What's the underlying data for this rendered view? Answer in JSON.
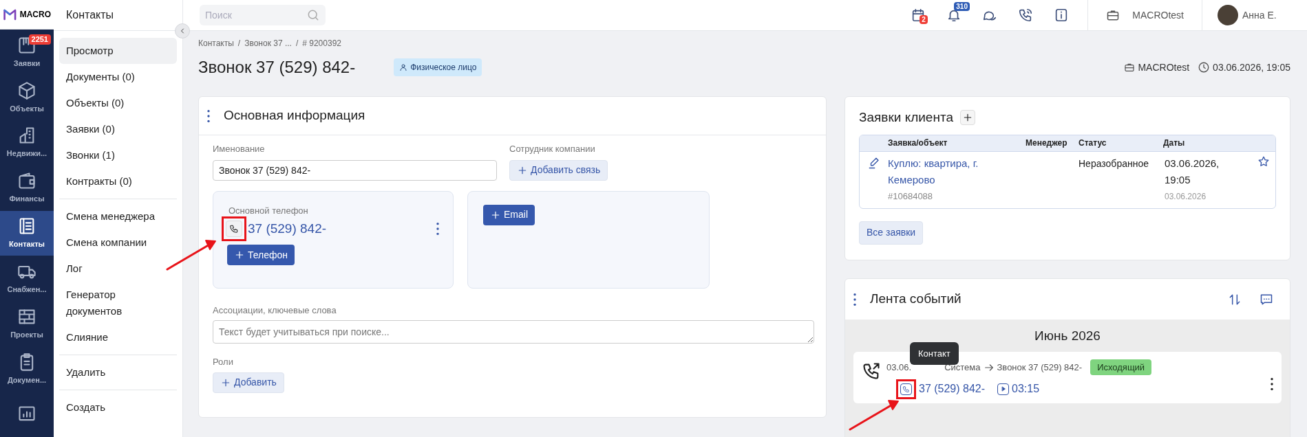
{
  "logo": {
    "text": "MACRO"
  },
  "nav": [
    {
      "label": "Заявки",
      "badge": "2251",
      "selected": false
    },
    {
      "label": "Объекты",
      "selected": false
    },
    {
      "label": "Недвижи...",
      "selected": false
    },
    {
      "label": "Финансы",
      "selected": false
    },
    {
      "label": "Контакты",
      "selected": true
    },
    {
      "label": "Снабжен...",
      "selected": false
    },
    {
      "label": "Проекты",
      "selected": false
    },
    {
      "label": "Докумен...",
      "selected": false
    },
    {
      "selected": false
    }
  ],
  "sidebar": {
    "title": "Контакты",
    "groups": [
      [
        {
          "label": "Просмотр",
          "selected": true
        },
        {
          "label": "Документы (0)",
          "selected": false
        },
        {
          "label": "Объекты (0)",
          "selected": false
        },
        {
          "label": "Заявки (0)",
          "selected": false
        },
        {
          "label": "Звонки (1)",
          "selected": false
        },
        {
          "label": "Контракты (0)",
          "selected": false
        }
      ],
      [
        {
          "label": "Смена менеджера",
          "selected": false
        },
        {
          "label": "Смена компании",
          "selected": false
        },
        {
          "label": "Лог",
          "selected": false
        },
        {
          "label": "Генератор документов",
          "selected": false
        },
        {
          "label": "Слияние",
          "selected": false
        }
      ],
      [
        {
          "label": "Удалить",
          "selected": false
        }
      ],
      [
        {
          "label": "Создать",
          "selected": false
        }
      ]
    ]
  },
  "topbar": {
    "search_placeholder": "Поиск",
    "calendar_badge": "2",
    "notifications_badge": "310",
    "company": "MACROtest",
    "user": "Анна Е."
  },
  "header": {
    "breadcrumbs": [
      "Контакты",
      "Звонок 37 ...",
      "# 9200392"
    ],
    "breadcrumb_separators": [
      "/",
      "/"
    ],
    "title": "Звонок 37 (529) 842-",
    "tag": "Физическое лицо",
    "company": "MACROtest",
    "date": "03.06.2026, 19:05"
  },
  "main_info": {
    "title": "Основная информация",
    "name": {
      "label": "Именование",
      "value": "Звонок 37 (529) 842-"
    },
    "employee": {
      "label": "Сотрудник компании",
      "button": "Добавить связь"
    },
    "phone": {
      "label": "Основной телефон",
      "number": "37 (529) 842-",
      "button": "Телефон"
    },
    "email": {
      "button": "Email"
    },
    "keywords": {
      "label": "Ассоциации, ключевые слова",
      "placeholder": "Текст будет учитываться при поиске..."
    },
    "roles": {
      "label": "Роли",
      "button": "Добавить"
    }
  },
  "client_requests": {
    "title": "Заявки клиента",
    "columns": [
      "Заявка/объект",
      "Менеджер",
      "Статус",
      "Даты"
    ],
    "rows": [
      {
        "title": "Куплю: квартира, г. Кемерово",
        "id": "#10684088",
        "status": "Неразобранное",
        "date": "03.06.2026, 19:05",
        "date_created": "03.06.2026",
        "starred": false
      }
    ],
    "button": "Все заявки"
  },
  "feed": {
    "title": "Лента событий",
    "month": "Июнь 2026",
    "events": [
      {
        "date": "03.06.",
        "from": "Система",
        "to": "Звонок 37 (529) 842-",
        "tag": "Исходящий",
        "phone": "37 (529) 842-",
        "duration": "03:15",
        "tooltip": "Контакт"
      }
    ]
  }
}
